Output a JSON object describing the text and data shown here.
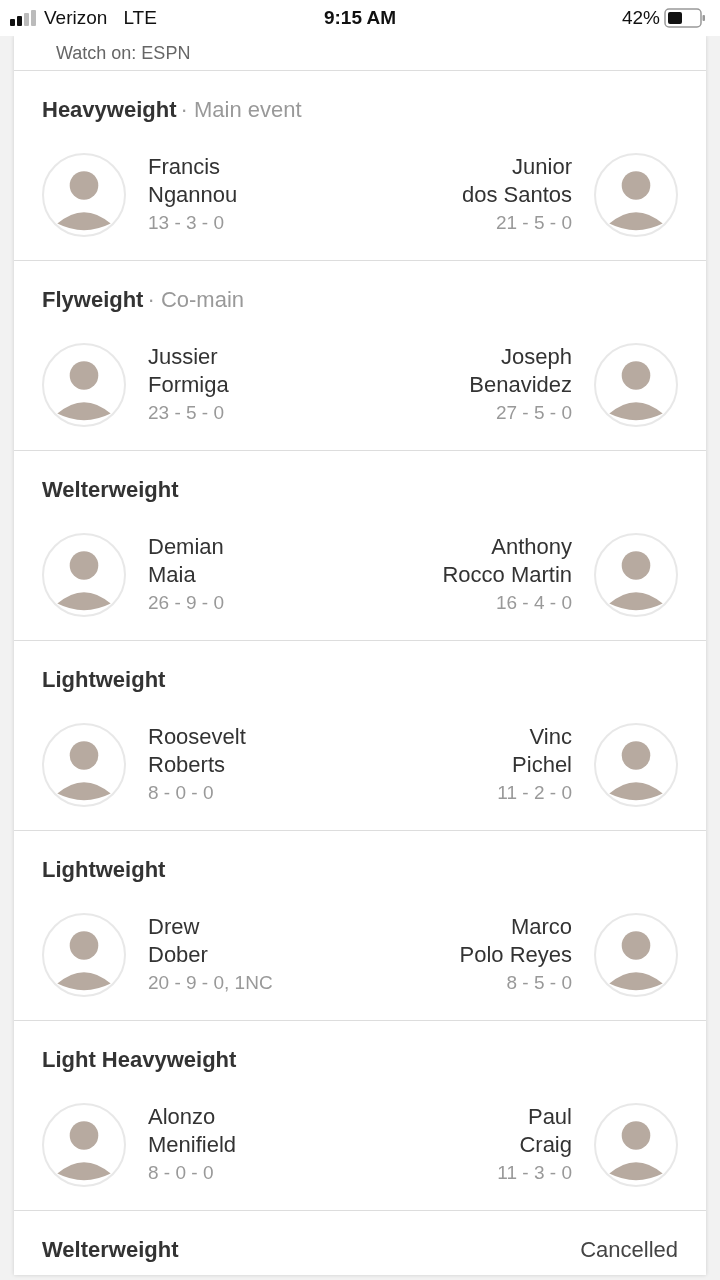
{
  "status_bar": {
    "carrier": "Verizon",
    "network": "LTE",
    "time": "9:15 AM",
    "battery": "42%"
  },
  "broadcast": {
    "text": "Watch on: ESPN"
  },
  "fights": [
    {
      "weight_class": "Heavyweight",
      "billing": "· Main event",
      "fighters": [
        {
          "first": "Francis",
          "last": "Ngannou",
          "record": "13 - 3 - 0"
        },
        {
          "first": "Junior",
          "last": "dos Santos",
          "record": "21 - 5 - 0"
        }
      ]
    },
    {
      "weight_class": "Flyweight",
      "billing": "· Co-main",
      "fighters": [
        {
          "first": "Jussier",
          "last": "Formiga",
          "record": "23 - 5 - 0"
        },
        {
          "first": "Joseph",
          "last": "Benavidez",
          "record": "27 - 5 - 0"
        }
      ]
    },
    {
      "weight_class": "Welterweight",
      "fighters": [
        {
          "first": "Demian",
          "last": "Maia",
          "record": "26 - 9 - 0"
        },
        {
          "first": "Anthony",
          "last": "Rocco Martin",
          "record": "16 - 4 - 0"
        }
      ]
    },
    {
      "weight_class": "Lightweight",
      "fighters": [
        {
          "first": "Roosevelt",
          "last": "Roberts",
          "record": "8 - 0 - 0"
        },
        {
          "first": "Vinc",
          "last": "Pichel",
          "record": "11 - 2 - 0"
        }
      ]
    },
    {
      "weight_class": "Lightweight",
      "fighters": [
        {
          "first": "Drew",
          "last": "Dober",
          "record": "20 - 9 - 0, 1NC"
        },
        {
          "first": "Marco",
          "last": "Polo Reyes",
          "record": "8 - 5 - 0"
        }
      ]
    },
    {
      "weight_class": "Light Heavyweight",
      "fighters": [
        {
          "first": "Alonzo",
          "last": "Menifield",
          "record": "8 - 0 - 0"
        },
        {
          "first": "Paul",
          "last": "Craig",
          "record": "11 - 3 - 0"
        }
      ]
    },
    {
      "weight_class": "Welterweight",
      "status": "Cancelled"
    }
  ]
}
